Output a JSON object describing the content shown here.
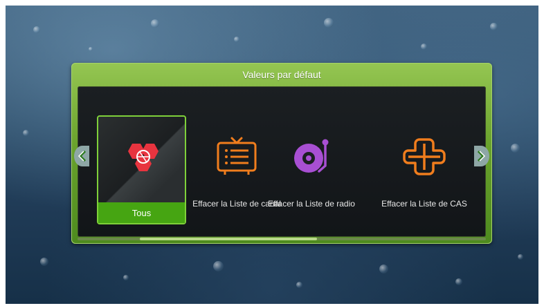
{
  "dialog": {
    "title": "Valeurs par défaut",
    "items": [
      {
        "label": "Tous",
        "icon": "tous-hexagon-icon",
        "selected": true,
        "color": "#e8343f"
      },
      {
        "label": "Effacer la Liste de canal",
        "icon": "tv-list-icon",
        "color": "#f07d1d"
      },
      {
        "label": "Effacer la Liste de radio",
        "icon": "vinyl-record-icon",
        "color": "#a84fd3"
      },
      {
        "label": "Effacer la Liste de CAS",
        "icon": "cas-cross-icon",
        "color": "#f07d1d"
      }
    ]
  },
  "colors": {
    "accent_green": "#6aa32d",
    "selected_bar": "#46a512",
    "panel_bg": "#121518"
  }
}
